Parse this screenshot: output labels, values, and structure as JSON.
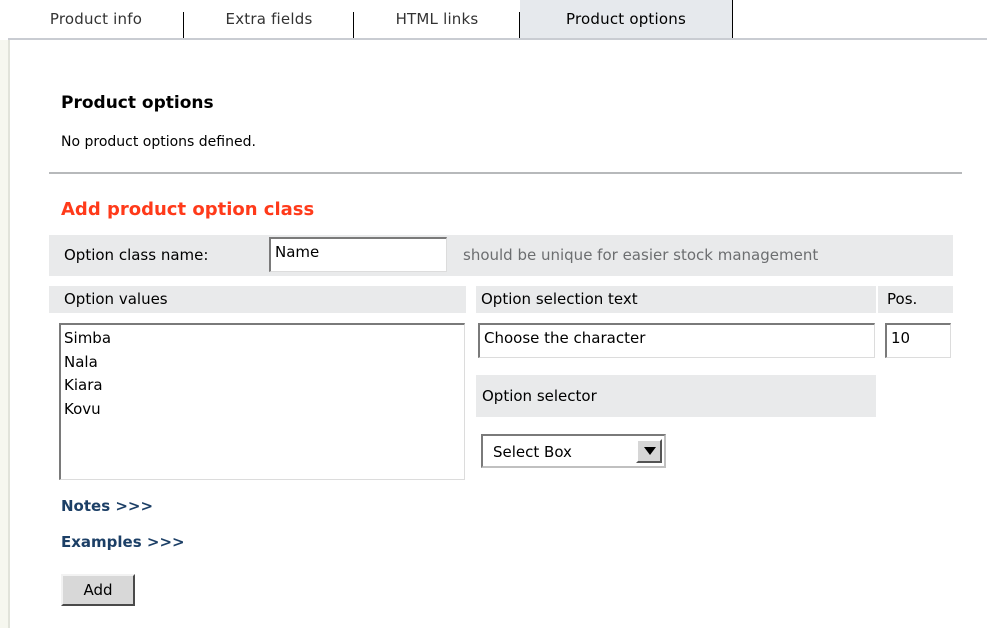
{
  "tabs": [
    {
      "label": "Product info"
    },
    {
      "label": "Extra fields"
    },
    {
      "label": "HTML links"
    },
    {
      "label": "Product options",
      "active": true
    }
  ],
  "product_options": {
    "title": "Product options",
    "empty_text": "No product options defined."
  },
  "add_class": {
    "title": "Add product option class",
    "class_name_label": "Option class name:",
    "class_name_value": "Name",
    "class_name_hint": "should be unique for easier stock management",
    "option_values_label": "Option values",
    "option_values": "Simba\nNala\nKiara\nKovu",
    "selection_text_label": "Option selection text",
    "selection_text_value": "Choose the character",
    "pos_label": "Pos.",
    "pos_value": "10",
    "selector_label": "Option selector",
    "selector_value": "Select Box",
    "notes_link": "Notes >>>",
    "examples_link": "Examples >>>",
    "add_button": "Add"
  },
  "colors": {
    "accent_title": "#ff3a1a",
    "link": "#1c3f66",
    "panel_grey": "#e9eaeb",
    "active_tab": "#e6e9ed"
  }
}
